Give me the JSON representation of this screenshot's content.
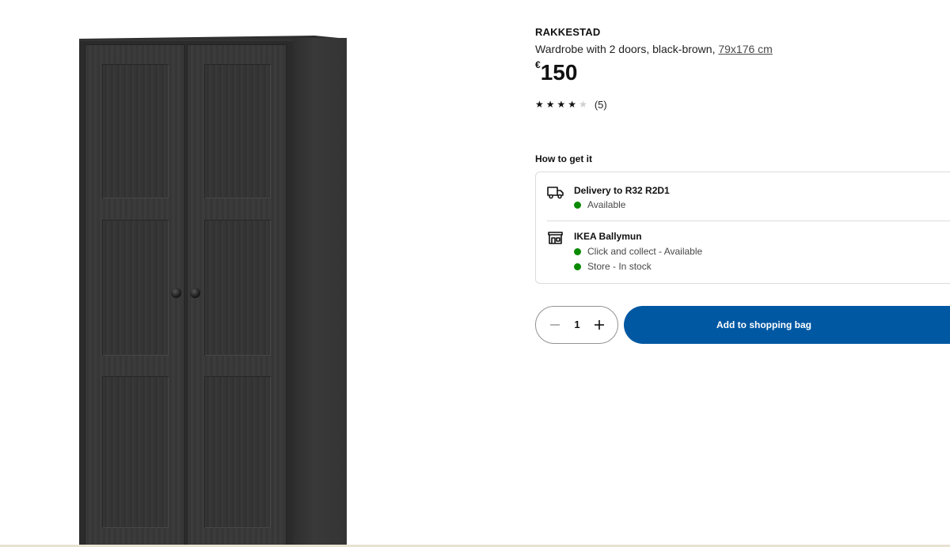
{
  "product": {
    "name": "RAKKESTAD",
    "description": "Wardrobe with 2 doors, black-brown,",
    "measurement": "79x176 cm",
    "price_currency": "€",
    "price_amount": "150",
    "rating": {
      "stars_filled": 4,
      "stars_total": 5,
      "count_label": "(5)"
    },
    "image_icon": "wardrobe-image"
  },
  "how_to_get_it": {
    "title": "How to get it",
    "delivery": {
      "icon": "truck-icon",
      "title": "Delivery to R32 R2D1",
      "status": "Available"
    },
    "store": {
      "icon": "store-icon",
      "title": "IKEA Ballymun",
      "statuses": [
        "Click and collect - Available",
        "Store - In stock"
      ]
    },
    "status_color": "#0a8a00"
  },
  "purchase": {
    "quantity": "1",
    "add_button_label": "Add to shopping bag",
    "button_color": "#0058a3"
  }
}
